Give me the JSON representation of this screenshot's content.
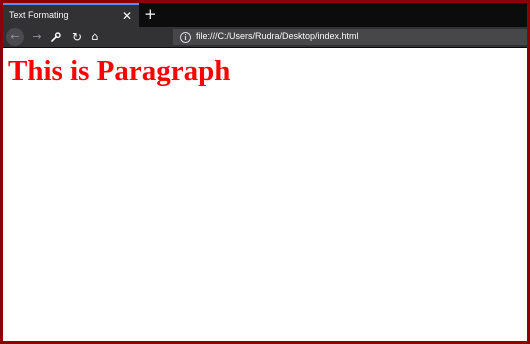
{
  "browser": {
    "tab": {
      "title": "Text Formating",
      "close_glyph": "✕"
    },
    "new_tab_glyph": "+",
    "nav": {
      "back_glyph": "←",
      "forward_glyph": "→",
      "tools_glyph": "🔧",
      "reload_glyph": "↻",
      "home_glyph": "⌂"
    },
    "urlbar": {
      "info_glyph": "i",
      "url": "file:///C:/Users/Rudra/Desktop/index.html"
    }
  },
  "page": {
    "heading": "This is Paragraph"
  },
  "icons": [
    "close-icon",
    "plus-icon",
    "back-arrow-icon",
    "forward-arrow-icon",
    "wrench-icon",
    "reload-icon",
    "home-icon",
    "info-icon"
  ],
  "colors": {
    "frame_border": "#8b0000",
    "heading": "#ff0000",
    "tab_accent": "#5a8ee8",
    "chrome_dark": "#0c0c0d",
    "chrome": "#323234"
  }
}
